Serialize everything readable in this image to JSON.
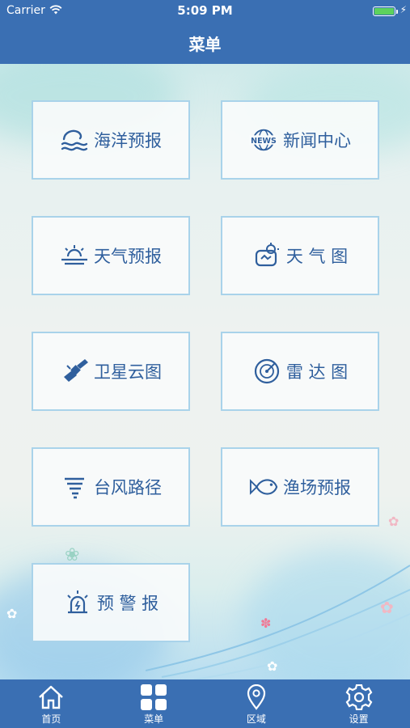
{
  "status_bar": {
    "carrier": "Carrier",
    "time": "5:09 PM",
    "battery_level": 1.0,
    "battery_color": "#5dd25d"
  },
  "header": {
    "title": "菜单"
  },
  "menu": {
    "items": [
      {
        "label": "海洋预报",
        "icon": "ocean-wave-icon"
      },
      {
        "label": "新闻中心",
        "icon": "news-globe-icon",
        "icon_text": "NEWS"
      },
      {
        "label": "天气预报",
        "icon": "sun-cloud-icon"
      },
      {
        "label": "天 气 图",
        "icon": "weather-map-icon"
      },
      {
        "label": "卫星云图",
        "icon": "satellite-icon"
      },
      {
        "label": "雷 达 图",
        "icon": "radar-icon"
      },
      {
        "label": "台风路径",
        "icon": "typhoon-icon"
      },
      {
        "label": "渔场预报",
        "icon": "fish-icon"
      },
      {
        "label": "预 警 报",
        "icon": "alarm-icon"
      }
    ]
  },
  "tabs": [
    {
      "label": "首页",
      "icon": "home-icon"
    },
    {
      "label": "菜单",
      "icon": "grid-menu-icon"
    },
    {
      "label": "区域",
      "icon": "location-pin-icon"
    },
    {
      "label": "设置",
      "icon": "gear-icon"
    }
  ],
  "colors": {
    "brand": "#3a6fb3",
    "tile_border": "#a9d3ea",
    "tile_text": "#2f5f9d"
  }
}
